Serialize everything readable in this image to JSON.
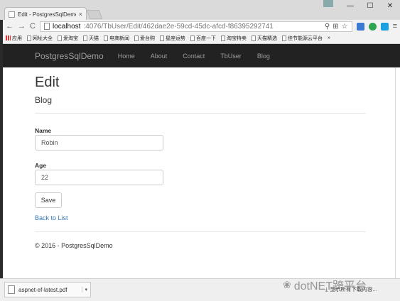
{
  "browser": {
    "tab_title": "Edit - PostgresSqlDemo",
    "tab_close": "×",
    "window_controls": {
      "user": "",
      "minimize": "—",
      "maximize": "☐",
      "close": "✕"
    },
    "back": "←",
    "forward": "→",
    "reload": "C",
    "url_host": "localhost",
    "url_path": ":4076/TbUser/Edit/462dae2e-59cd-45dc-afcd-f86395292741",
    "menu": "≡",
    "bookmarks": [
      "应用",
      "网址大全",
      "爱淘宝",
      "天猫",
      "电商新闻",
      "爱台购",
      "星座运势",
      "百度一下",
      "淘宝特卖",
      "天猫精选",
      "佳节能源云平台"
    ],
    "bookmarks_more": "»"
  },
  "site": {
    "brand": "PostgresSqlDemo",
    "nav": [
      "Home",
      "About",
      "Contact",
      "TbUser",
      "Blog"
    ]
  },
  "form": {
    "title": "Edit",
    "subtitle": "Blog",
    "name_label": "Name",
    "name_value": "Robin",
    "age_label": "Age",
    "age_value": "22",
    "save_label": "Save",
    "back_link": "Back to List"
  },
  "footer": {
    "text": "© 2016 - PostgresSqlDemo"
  },
  "downloads": {
    "file": "aspnet-ef-latest.pdf",
    "show_all": "显示所有下载内容..."
  },
  "watermark": "dotNET跨平台",
  "colors": {
    "navbar": "#222222",
    "link": "#337ab7"
  }
}
